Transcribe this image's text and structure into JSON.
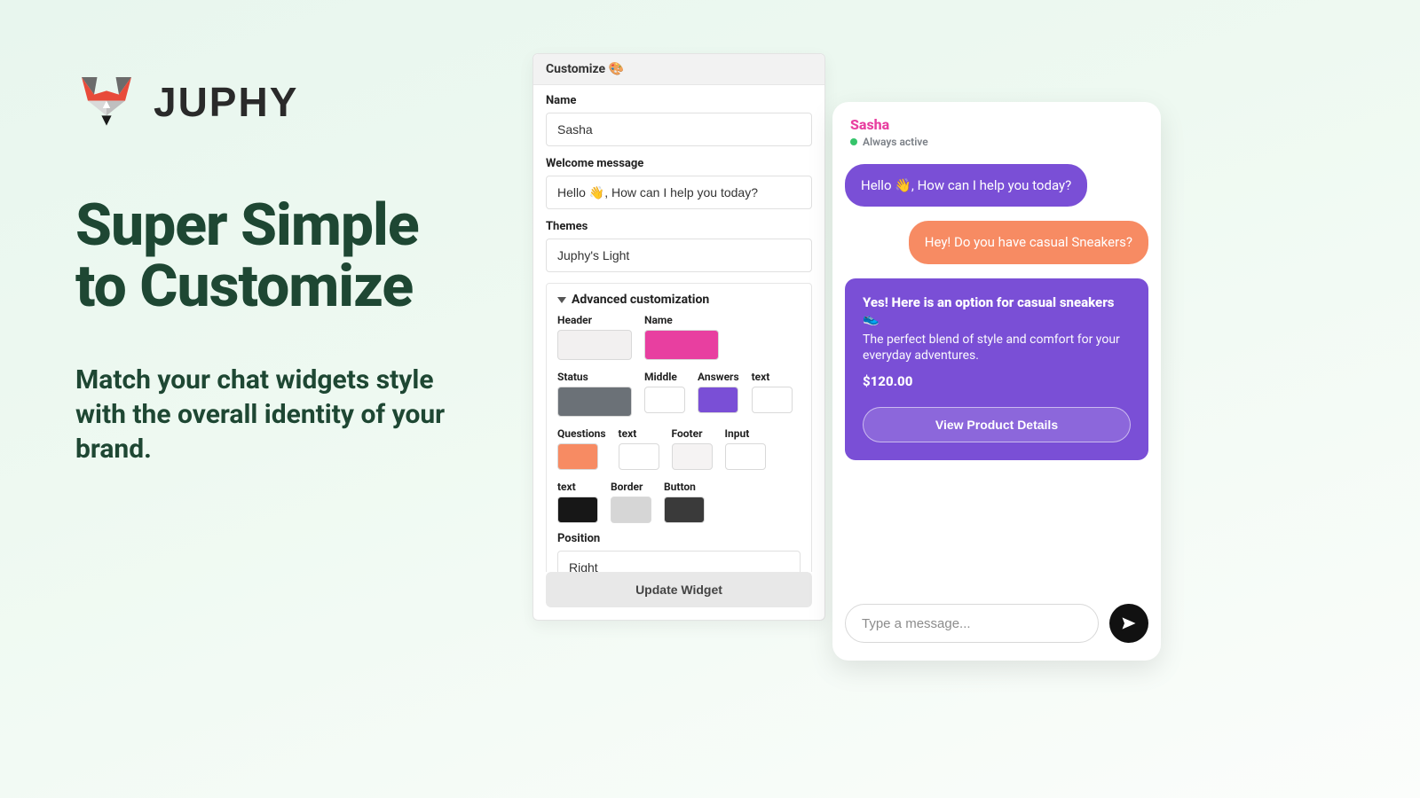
{
  "brand": {
    "name": "JUPHY"
  },
  "marketing": {
    "headline": "Super Simple to Customize",
    "subhead": "Match your chat widgets style with the overall identity of your brand."
  },
  "customize": {
    "panel_title": "Customize 🎨",
    "name_label": "Name",
    "name_value": "Sasha",
    "welcome_label": "Welcome message",
    "welcome_value": "Hello 👋, How can I help you today?",
    "themes_label": "Themes",
    "themes_value": "Juphy's Light",
    "advanced_label": "Advanced customization",
    "swatches": {
      "header": {
        "label": "Header",
        "color": "#f2f0f0"
      },
      "name": {
        "label": "Name",
        "color": "#e83fa0"
      },
      "status": {
        "label": "Status",
        "color": "#6b7177"
      },
      "middle": {
        "label": "Middle",
        "color": "#ffffff"
      },
      "answers": {
        "label": "Answers",
        "color": "#7a4fd6"
      },
      "answers_text": {
        "label": "text",
        "color": "#ffffff"
      },
      "questions": {
        "label": "Questions",
        "color": "#f78b63"
      },
      "questions_text": {
        "label": "text",
        "color": "#ffffff"
      },
      "footer": {
        "label": "Footer",
        "color": "#f5f3f3"
      },
      "input": {
        "label": "Input",
        "color": "#ffffff"
      },
      "input_text": {
        "label": "text",
        "color": "#171717"
      },
      "border": {
        "label": "Border",
        "color": "#d6d6d6"
      },
      "button": {
        "label": "Button",
        "color": "#3a3a3a"
      }
    },
    "position_label": "Position",
    "position_value": "Right",
    "update_label": "Update Widget"
  },
  "chat": {
    "name": "Sasha",
    "name_color": "#e83fa0",
    "status": "Always active",
    "answers_color": "#7a4fd6",
    "questions_color": "#f78b63",
    "greeting": "Hello 👋,  How can I help you today?",
    "user_msg": "Hey! Do you have casual Sneakers?",
    "product": {
      "title": "Yes! Here is an option for casual sneakers 👟",
      "desc": "The perfect blend of style and comfort for your everyday adventures.",
      "price": "$120.00",
      "cta": "View Product Details"
    },
    "input_placeholder": "Type a message..."
  }
}
